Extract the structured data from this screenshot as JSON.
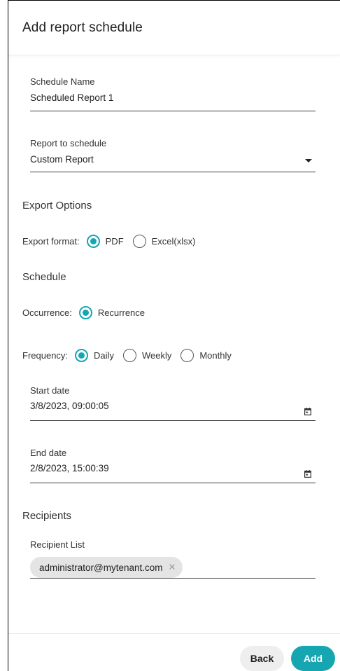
{
  "dialog": {
    "title": "Add report schedule"
  },
  "schedule_name": {
    "label": "Schedule Name",
    "value": "Scheduled Report 1"
  },
  "report_to_schedule": {
    "label": "Report to schedule",
    "value": "Custom Report"
  },
  "export_options": {
    "title": "Export Options",
    "format_label": "Export format:",
    "options": [
      {
        "label": "PDF",
        "checked": true
      },
      {
        "label": "Excel(xlsx)",
        "checked": false
      }
    ]
  },
  "schedule": {
    "title": "Schedule",
    "occurrence_label": "Occurrence:",
    "occurrence_options": [
      {
        "label": "Recurrence",
        "checked": true
      }
    ],
    "frequency_label": "Frequency:",
    "frequency_options": [
      {
        "label": "Daily",
        "checked": true
      },
      {
        "label": "Weekly",
        "checked": false
      },
      {
        "label": "Monthly",
        "checked": false
      }
    ]
  },
  "start_date": {
    "label": "Start date",
    "value": "3/8/2023, 09:00:05"
  },
  "end_date": {
    "label": "End date",
    "value": "2/8/2023, 15:00:39"
  },
  "recipients": {
    "title": "Recipients",
    "list_label": "Recipient List",
    "chips": [
      {
        "label": "administrator@mytenant.com"
      }
    ]
  },
  "footer": {
    "back_label": "Back",
    "add_label": "Add"
  },
  "colors": {
    "accent": "#15a6b2",
    "back_button_bg": "#eeeeee",
    "chip_bg": "#e4e4e4"
  },
  "icons": {
    "dropdown": "chevron-down-icon",
    "calendar": "calendar-icon",
    "chip_remove": "close-icon"
  }
}
